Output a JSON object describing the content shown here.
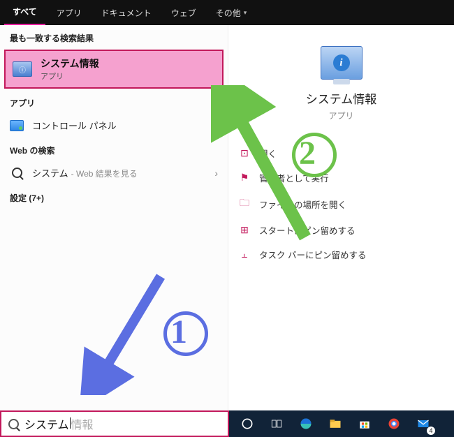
{
  "tabs": {
    "all": "すべて",
    "apps": "アプリ",
    "documents": "ドキュメント",
    "web": "ウェブ",
    "more": "その他"
  },
  "left": {
    "best_match_header": "最も一致する検索結果",
    "best_match": {
      "title": "システム情報",
      "subtitle": "アプリ"
    },
    "apps_header": "アプリ",
    "control_panel": "コントロール パネル",
    "web_header": "Web の検索",
    "web_item_prefix": "システム",
    "web_item_suffix": "- Web 結果を見る",
    "settings_header": "設定 (7+)"
  },
  "preview": {
    "title": "システム情報",
    "subtitle": "アプリ",
    "actions": {
      "open": "開く",
      "run_admin": "管理者として実行",
      "open_location": "ファイルの場所を開く",
      "pin_start": "スタートにピン留めする",
      "pin_taskbar": "タスク バーにピン留めする"
    }
  },
  "annotations": {
    "step1": "1",
    "step2": "2"
  },
  "search": {
    "typed": "システム",
    "rest": "情報"
  },
  "taskbar": {
    "icons": [
      "cortana",
      "taskview",
      "edge",
      "explorer",
      "store",
      "chrome",
      "mail"
    ],
    "mail_badge": "4"
  }
}
